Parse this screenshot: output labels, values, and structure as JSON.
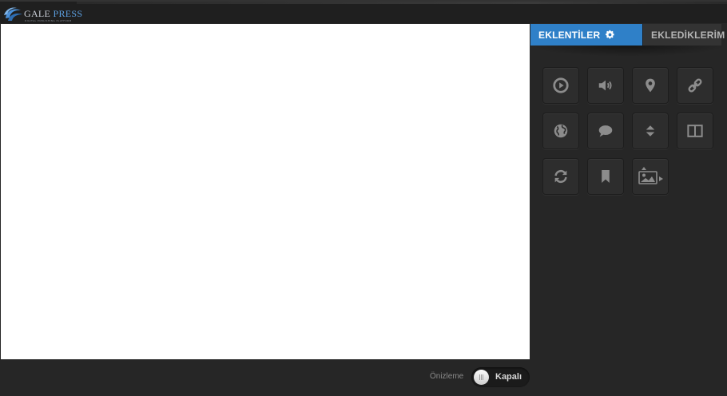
{
  "brand": {
    "name_part1": "Gale",
    "name_part2": "Press",
    "tagline": "DIGITAL PUBLISHING PLATFORM"
  },
  "sidepanel": {
    "tabs": [
      {
        "label": "EKLENTİLER",
        "icon": "gear-icon",
        "active": true
      },
      {
        "label": "EKLEDİKLERİM",
        "icon": "sitemap-icon",
        "active": false
      }
    ],
    "tools": [
      {
        "icon": "video-icon"
      },
      {
        "icon": "audio-icon"
      },
      {
        "icon": "map-marker-icon"
      },
      {
        "icon": "link-icon"
      },
      {
        "icon": "globe-icon"
      },
      {
        "icon": "comment-icon"
      },
      {
        "icon": "scroll-icon"
      },
      {
        "icon": "split-view-icon"
      },
      {
        "icon": "refresh-icon"
      },
      {
        "icon": "bookmark-icon"
      },
      {
        "icon": "slideshow-icon"
      }
    ]
  },
  "footer": {
    "preview_label": "Önizleme",
    "toggle_state": "Kapalı"
  },
  "colors": {
    "accent": "#2f80c8",
    "background": "#262626",
    "canvas": "#ffffff"
  }
}
